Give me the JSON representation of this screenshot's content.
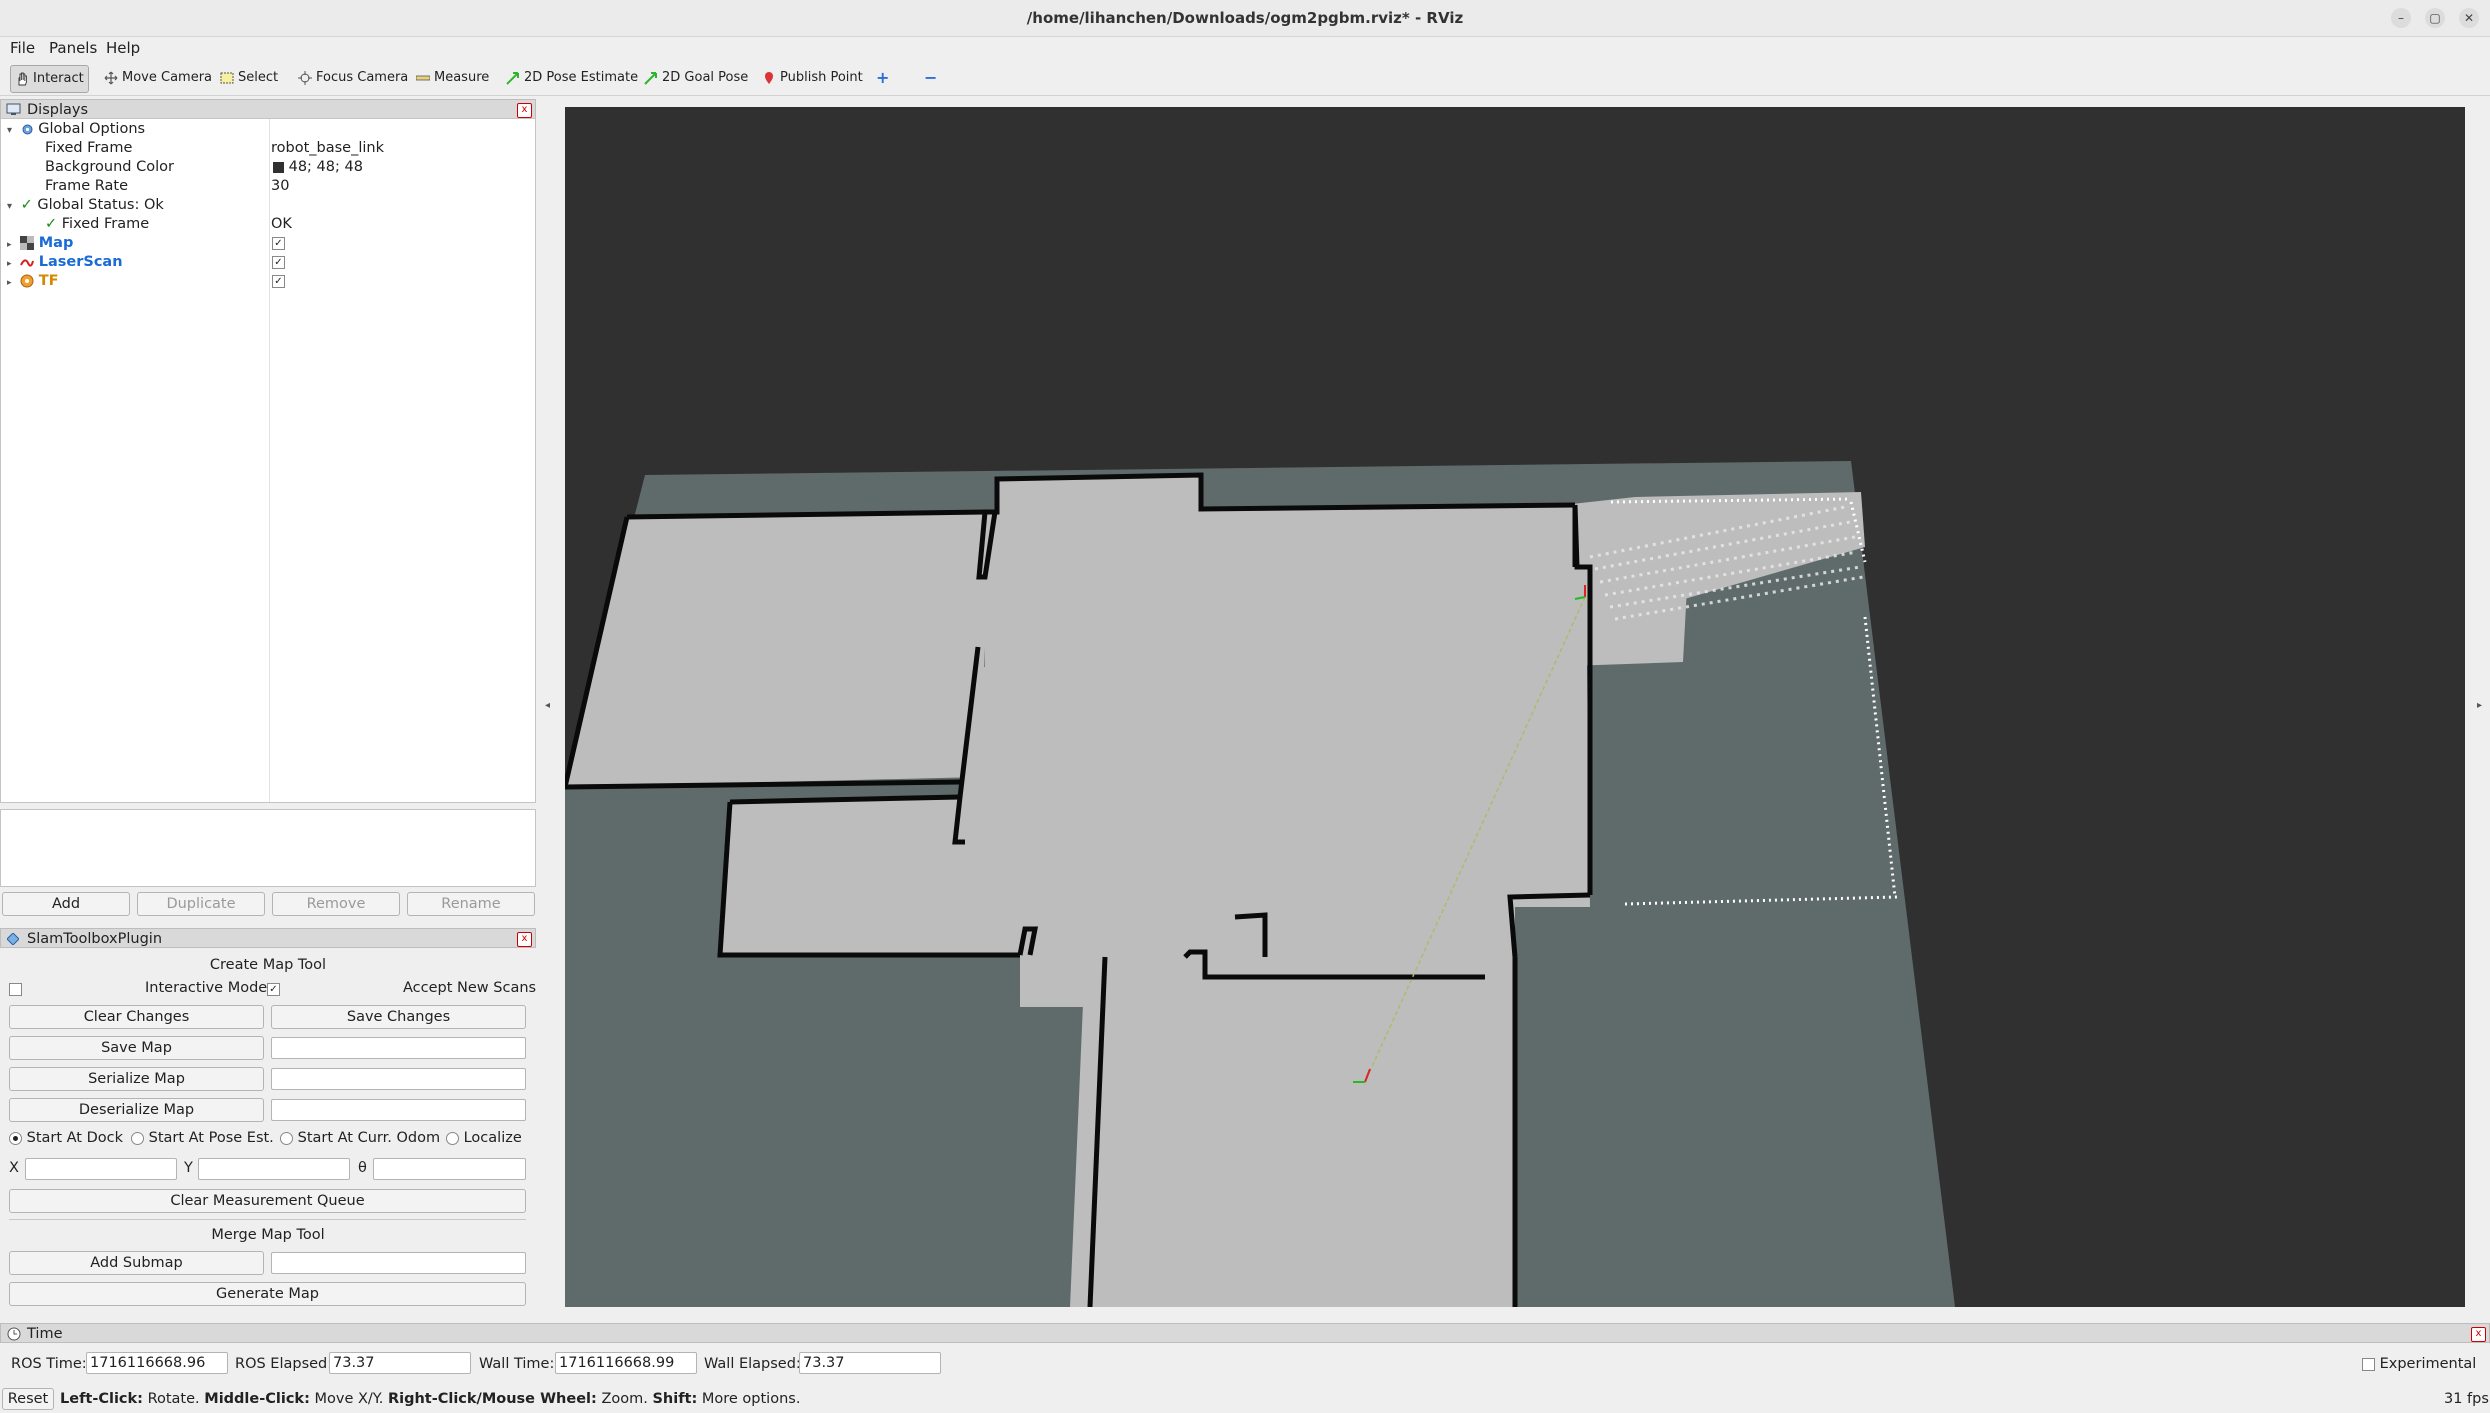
{
  "window": {
    "title": "/home/lihanchen/Downloads/ogm2pgbm.rviz* - RViz",
    "controls": [
      "–",
      "▢",
      "✕"
    ]
  },
  "menu": [
    "File",
    "Panels",
    "Help"
  ],
  "toolbar": {
    "tools": [
      "Interact",
      "Move Camera",
      "Select",
      "Focus Camera",
      "Measure",
      "2D Pose Estimate",
      "2D Goal Pose",
      "Publish Point"
    ],
    "extra": [
      "+",
      "−"
    ]
  },
  "displays": {
    "title": "Displays",
    "global_options": "Global Options",
    "fixed_frame_label": "Fixed Frame",
    "fixed_frame_value": "robot_base_link",
    "background_color_label": "Background Color",
    "background_color_value": "48; 48; 48",
    "background_color_hex": "#303030",
    "frame_rate_label": "Frame Rate",
    "frame_rate_value": "30",
    "global_status": "Global Status: Ok",
    "status_fixed_frame_label": "Fixed Frame",
    "status_fixed_frame_value": "OK",
    "items": [
      {
        "name": "Map",
        "checked": true,
        "color": "#1a6bd6"
      },
      {
        "name": "LaserScan",
        "checked": true,
        "color": "#1a6bd6"
      },
      {
        "name": "TF",
        "checked": true,
        "color": "#d48a00"
      }
    ],
    "buttons": {
      "add": "Add",
      "duplicate": "Duplicate",
      "remove": "Remove",
      "rename": "Rename"
    }
  },
  "slam": {
    "title": "SlamToolboxPlugin",
    "create_map_tool": "Create Map Tool",
    "interactive_mode": "Interactive Mode",
    "accept_new_scans": "Accept New Scans",
    "clear_changes": "Clear Changes",
    "save_changes": "Save Changes",
    "save_map": "Save Map",
    "serialize_map": "Serialize Map",
    "deserialize_map": "Deserialize Map",
    "start_options": [
      "Start At Dock",
      "Start At Pose Est.",
      "Start At Curr. Odom",
      "Localize"
    ],
    "x_label": "X",
    "y_label": "Y",
    "theta_label": "θ",
    "clear_measurement_queue": "Clear Measurement Queue",
    "merge_map_tool": "Merge Map Tool",
    "add_submap": "Add Submap",
    "generate_map": "Generate Map"
  },
  "time": {
    "title": "Time",
    "ros_time_label": "ROS Time:",
    "ros_time_value": "1716116668.96",
    "ros_elapsed_label": "ROS Elapsed:",
    "ros_elapsed_value": "73.37",
    "wall_time_label": "Wall Time:",
    "wall_time_value": "1716116668.99",
    "wall_elapsed_label": "Wall Elapsed:",
    "wall_elapsed_value": "73.37",
    "experimental": "Experimental"
  },
  "status": {
    "reset": "Reset",
    "left_click": "Left-Click:",
    "left_click_desc": "Rotate.",
    "middle_click": "Middle-Click:",
    "middle_click_desc": "Move X/Y.",
    "right_click": "Right-Click/Mouse Wheel:",
    "right_click_desc": "Zoom.",
    "shift": "Shift:",
    "shift_desc": "More options.",
    "fps": "31 fps"
  },
  "viewport": {
    "colors": {
      "background": "#303030",
      "map_unknown": "#5f6b6a",
      "map_free": "#bdbdbd",
      "map_wall": "#0a0a0a"
    }
  }
}
